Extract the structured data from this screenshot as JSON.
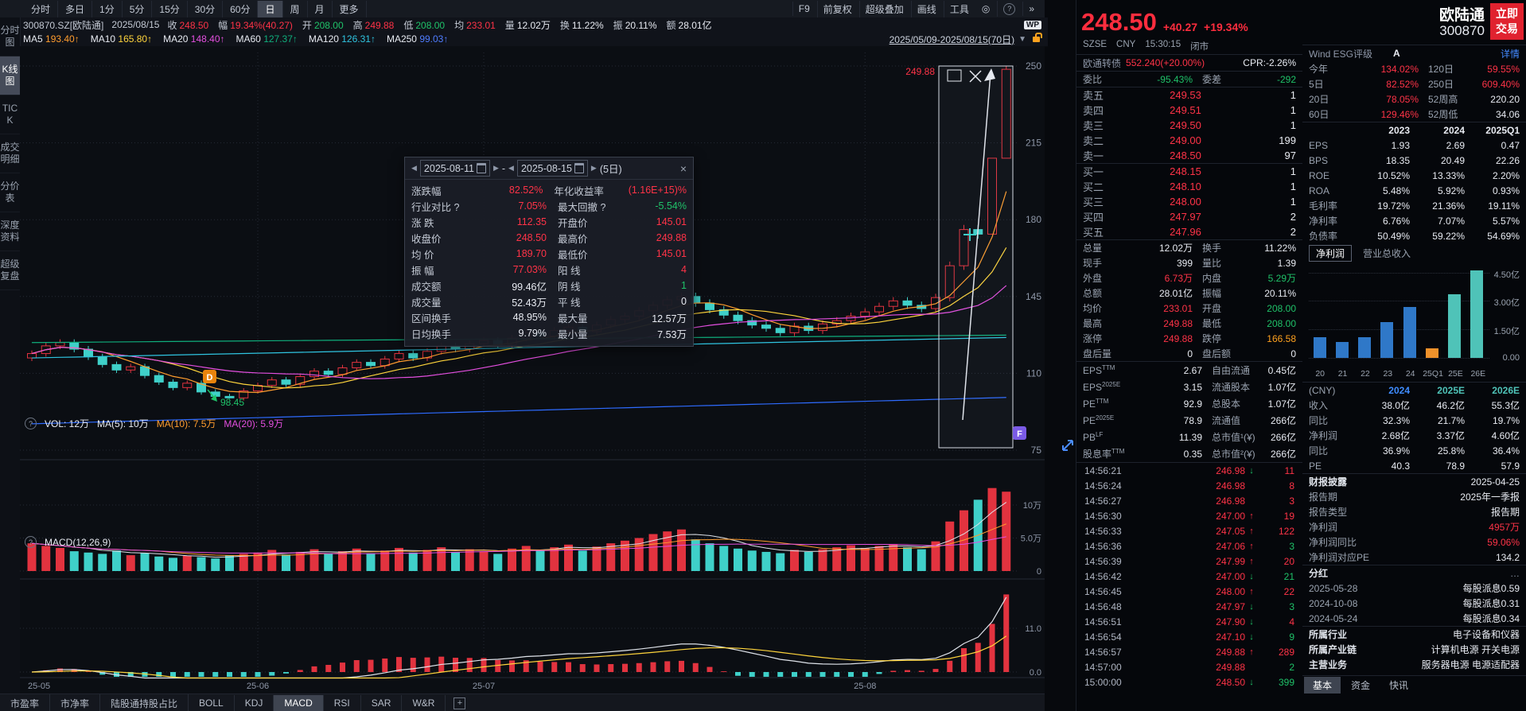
{
  "palette": {
    "red": "#ff3347",
    "green": "#1fc269",
    "teal": "#3fd0c9",
    "candle_red": "#e2333f",
    "orange": "#ff9d2e",
    "yellow": "#ffd53c",
    "magenta": "#e44fe0",
    "ma_green": "#0fae7c",
    "cyan": "#2fc4e0",
    "blue": "#2e6bff",
    "link": "#448aff",
    "gold": "#ffa21f",
    "badge_d": "#e8830c",
    "badge_f": "#7b5be6"
  },
  "top_tabs": {
    "items": [
      "分时",
      "多日",
      "1分",
      "5分",
      "15分",
      "30分",
      "60分",
      "日",
      "周",
      "月",
      "更多"
    ],
    "active": "日",
    "right": [
      "F9",
      "前复权",
      "超级叠加",
      "画线",
      "工具"
    ]
  },
  "info_bar": {
    "code": "300870.SZ[欧陆通]",
    "date": "2025/08/15",
    "wp": "WP",
    "fields": [
      [
        "收",
        "248.50",
        "r"
      ],
      [
        "幅",
        "19.34%(40.27)",
        "r"
      ],
      [
        "开",
        "208.00",
        "g"
      ],
      [
        "高",
        "249.88",
        "r"
      ],
      [
        "低",
        "208.00",
        "g"
      ],
      [
        "均",
        "233.01",
        "r"
      ],
      [
        "量",
        "12.02万",
        "w"
      ],
      [
        "换",
        "11.22%",
        "w"
      ],
      [
        "振",
        "20.11%",
        "w"
      ],
      [
        "额",
        "28.01亿",
        "w"
      ]
    ]
  },
  "ma_bar": {
    "items": [
      [
        "MA5",
        "193.40↑",
        "org"
      ],
      [
        "MA10",
        "165.80↑",
        "yel"
      ],
      [
        "MA20",
        "148.40↑",
        "mag"
      ],
      [
        "MA60",
        "127.37↑",
        "magreen"
      ],
      [
        "MA120",
        "126.31↑",
        "cyan"
      ],
      [
        "MA250",
        "99.03↑",
        "blue"
      ]
    ],
    "range": "2025/05/09-2025/08/15(70日)"
  },
  "sidebar": {
    "items": [
      "分时图",
      "K线图",
      "TICK",
      "成交明细",
      "分价表",
      "深度资料",
      "超级复盘"
    ],
    "active": "K线图"
  },
  "chart": {
    "closes": [
      119.0,
      122.5,
      124.0,
      121.0,
      117.5,
      114.0,
      111.5,
      113.0,
      109.0,
      106.0,
      103.5,
      105.5,
      101.5,
      99.5,
      98.8,
      102.0,
      104.5,
      107.0,
      105.0,
      108.5,
      111.0,
      109.5,
      112.5,
      115.0,
      113.5,
      116.5,
      119.0,
      117.0,
      120.0,
      122.5,
      121.0,
      123.5,
      125.0,
      123.0,
      126.0,
      128.5,
      127.0,
      129.5,
      131.0,
      129.0,
      132.0,
      134.5,
      136.0,
      138.5,
      141.0,
      143.5,
      145.0,
      142.0,
      139.0,
      136.5,
      134.0,
      132.0,
      130.5,
      128.5,
      131.5,
      129.5,
      132.5,
      134.0,
      136.0,
      138.0,
      140.5,
      143.0,
      141.0,
      139.5,
      144.5,
      159.0,
      175.5,
      173.4,
      208.0,
      248.5
    ],
    "vols": [
      4.2,
      3.8,
      3.5,
      3.0,
      2.8,
      2.6,
      3.1,
      2.4,
      2.7,
      2.2,
      2.0,
      2.3,
      2.1,
      1.9,
      2.4,
      2.6,
      2.8,
      3.2,
      2.5,
      2.9,
      3.3,
      2.6,
      3.0,
      3.4,
      2.7,
      3.1,
      3.5,
      2.8,
      3.2,
      3.6,
      2.9,
      3.3,
      3.0,
      2.6,
      3.4,
      3.8,
      3.2,
      3.6,
      4.0,
      3.1,
      3.7,
      4.2,
      4.6,
      5.0,
      5.6,
      6.0,
      6.3,
      4.8,
      4.2,
      3.8,
      3.4,
      3.1,
      2.9,
      2.7,
      3.2,
      2.9,
      3.3,
      3.6,
      3.9,
      3.5,
      3.8,
      4.1,
      3.6,
      3.3,
      4.5,
      7.5,
      9.2,
      10.8,
      12.57,
      12.02
    ],
    "overrides": {
      "14": {
        "low": 98.45
      },
      "68": {
        "open": 173.4,
        "high": 208.0,
        "low": 173.4
      },
      "69": {
        "open": 208.0,
        "high": 249.88,
        "low": 208.0
      }
    },
    "months": [
      [
        "25-05",
        0
      ],
      [
        "25-06",
        16
      ],
      [
        "25-07",
        32
      ],
      [
        "25-08",
        59
      ]
    ],
    "y_labels": [
      250,
      215,
      180,
      145,
      110,
      75
    ],
    "ma_synth": {
      "ma60": [
        124.0,
        127.4
      ],
      "ma120": [
        117.0,
        126.3
      ],
      "ma250": [
        87.0,
        99.0
      ]
    },
    "vol_axis": [
      "10万",
      "5.0万",
      "0"
    ],
    "macd_axis": [
      "11.0",
      "0.0"
    ],
    "overlays": {
      "d_badge": "D",
      "f_badge": "F",
      "low_label": "98.45",
      "sel_high": "249.88"
    }
  },
  "vol_row": {
    "vol": "VOL: 12万",
    "ma5": "MA(5): 10万",
    "ma10": "MA(10): 7.5万",
    "ma20": "MA(20): 5.9万"
  },
  "macd_row": {
    "label": "MACD(12,26,9)"
  },
  "bottom_tabs": {
    "items": [
      "市盈率",
      "市净率",
      "陆股通持股占比",
      "BOLL",
      "KDJ",
      "MACD",
      "RSI",
      "SAR",
      "W&R"
    ],
    "active": "MACD"
  },
  "tooltip": {
    "start": "2025-08-11",
    "end": "2025-08-15",
    "period": "(5日)",
    "close": "×",
    "rows": [
      [
        "涨跌幅",
        "82.52%",
        "r",
        "年化收益率",
        "(1.16E+15)%",
        "r"
      ],
      [
        "行业对比 ?",
        "7.05%",
        "r",
        "最大回撤 ?",
        "-5.54%",
        "g"
      ],
      [
        "涨 跌",
        "112.35",
        "r",
        "开盘价",
        "145.01",
        "r"
      ],
      [
        "收盘价",
        "248.50",
        "r",
        "最高价",
        "249.88",
        "r"
      ],
      [
        "均 价",
        "189.70",
        "r",
        "最低价",
        "145.01",
        "r"
      ],
      [
        "振 幅",
        "77.03%",
        "r",
        "阳 线",
        "4",
        "r"
      ],
      [
        "成交额",
        "99.46亿",
        "w",
        "阴 线",
        "1",
        "g"
      ],
      [
        "成交量",
        "52.43万",
        "w",
        "平 线",
        "0",
        "w"
      ],
      [
        "区间换手",
        "48.95%",
        "w",
        "最大量",
        "12.57万",
        "w"
      ],
      [
        "日均换手",
        "9.79%",
        "w",
        "最小量",
        "7.53万",
        "w"
      ]
    ]
  },
  "quote": {
    "price": "248.50",
    "chg": "+40.27",
    "pct": "+19.34%",
    "meta": [
      "SZSE",
      "CNY",
      "15:30:15",
      "闭市"
    ],
    "bond": {
      "name": "欧通转债",
      "val": "552.240(+20.00%)",
      "cpr": "CPR:-2.26%"
    },
    "wb": [
      "委比",
      "-95.43%",
      "g",
      "委差",
      "-292",
      "g"
    ],
    "asks": [
      [
        "卖五",
        "249.53",
        "1"
      ],
      [
        "卖四",
        "249.51",
        "1"
      ],
      [
        "卖三",
        "249.50",
        "1"
      ],
      [
        "卖二",
        "249.00",
        "199"
      ],
      [
        "卖一",
        "248.50",
        "97"
      ]
    ],
    "bids": [
      [
        "买一",
        "248.15",
        "1"
      ],
      [
        "买二",
        "248.10",
        "1"
      ],
      [
        "买三",
        "248.00",
        "1"
      ],
      [
        "买四",
        "247.97",
        "2"
      ],
      [
        "买五",
        "247.96",
        "2"
      ]
    ],
    "stats": [
      [
        "总量",
        "12.02万",
        "w",
        "换手",
        "11.22%",
        "w"
      ],
      [
        "现手",
        "399",
        "w",
        "量比",
        "1.39",
        "w"
      ],
      [
        "外盘",
        "6.73万",
        "r",
        "内盘",
        "5.29万",
        "g"
      ],
      [
        "总额",
        "28.01亿",
        "w",
        "振幅",
        "20.11%",
        "w"
      ],
      [
        "均价",
        "233.01",
        "r",
        "开盘",
        "208.00",
        "g"
      ],
      [
        "最高",
        "249.88",
        "r",
        "最低",
        "208.00",
        "g"
      ],
      [
        "涨停",
        "249.88",
        "r",
        "跌停",
        "166.58",
        "o"
      ],
      [
        "盘后量",
        "0",
        "w",
        "盘后额",
        "0",
        "w"
      ]
    ],
    "fins": [
      [
        "EPS",
        "TTM",
        "2.67",
        "自由流通",
        "0.45亿"
      ],
      [
        "EPS",
        "2025E",
        "3.15",
        "流通股本",
        "1.07亿"
      ],
      [
        "PE",
        "TTM",
        "92.9",
        "总股本",
        "1.07亿"
      ],
      [
        "PE",
        "2025E",
        "78.9",
        "流通值",
        "266亿"
      ],
      [
        "PB",
        "LF",
        "11.39",
        "总市值¹(¥)",
        "266亿"
      ],
      [
        "股息率",
        "TTM",
        "0.35",
        "总市值²(¥)",
        "266亿"
      ]
    ],
    "ticks": [
      [
        "14:56:21",
        "246.98",
        "down",
        "11",
        "r"
      ],
      [
        "14:56:24",
        "246.98",
        "",
        "8",
        "r"
      ],
      [
        "14:56:27",
        "246.98",
        "",
        "3",
        "r"
      ],
      [
        "14:56:30",
        "247.00",
        "up",
        "19",
        "r"
      ],
      [
        "14:56:33",
        "247.05",
        "up",
        "122",
        "r"
      ],
      [
        "14:56:36",
        "247.06",
        "up",
        "3",
        "g"
      ],
      [
        "14:56:39",
        "247.99",
        "up",
        "20",
        "r"
      ],
      [
        "14:56:42",
        "247.00",
        "down",
        "21",
        "g"
      ],
      [
        "14:56:45",
        "248.00",
        "up",
        "22",
        "r"
      ],
      [
        "14:56:48",
        "247.97",
        "down",
        "3",
        "g"
      ],
      [
        "14:56:51",
        "247.90",
        "down",
        "4",
        "r"
      ],
      [
        "14:56:54",
        "247.10",
        "down",
        "9",
        "g"
      ],
      [
        "14:56:57",
        "249.88",
        "up",
        "289",
        "r"
      ],
      [
        "14:57:00",
        "249.88",
        "",
        "2",
        "g"
      ],
      [
        "15:00:00",
        "248.50",
        "down",
        "399",
        "g"
      ]
    ]
  },
  "colB": {
    "name": "欧陆通",
    "code": "300870",
    "trade1": "立即",
    "trade2": "交易",
    "esg": {
      "label": "Wind ESG评级",
      "value": "A",
      "link": "详情"
    },
    "perf": [
      [
        "今年",
        "134.02%",
        "r",
        "120日",
        "59.55%",
        "r"
      ],
      [
        "5日",
        "82.52%",
        "r",
        "250日",
        "609.40%",
        "r"
      ],
      [
        "20日",
        "78.05%",
        "r",
        "52周高",
        "220.20",
        "w"
      ],
      [
        "60日",
        "129.46%",
        "r",
        "52周低",
        "34.06",
        "w"
      ]
    ],
    "fin_table": {
      "headers": [
        "",
        "2023",
        "2024",
        "2025Q1"
      ],
      "rows": [
        [
          "EPS",
          "1.93",
          "2.69",
          "0.47"
        ],
        [
          "BPS",
          "18.35",
          "20.49",
          "22.26"
        ],
        [
          "ROE",
          "10.52%",
          "13.33%",
          "2.20%"
        ],
        [
          "ROA",
          "5.48%",
          "5.92%",
          "0.93%"
        ],
        [
          "毛利率",
          "19.72%",
          "21.36%",
          "19.11%"
        ],
        [
          "净利率",
          "6.76%",
          "7.07%",
          "5.57%"
        ],
        [
          "负债率",
          "50.49%",
          "59.22%",
          "54.69%"
        ]
      ]
    },
    "bar_tabs": {
      "active": "净利润",
      "other": "营业总收入"
    },
    "chart_data": {
      "type": "bar",
      "title": "净利润",
      "categories": [
        "20",
        "21",
        "22",
        "23",
        "24",
        "25Q1",
        "25E",
        "26E"
      ],
      "values": [
        1.1,
        0.85,
        1.1,
        1.9,
        2.68,
        0.5,
        3.37,
        4.6
      ],
      "ylim": [
        0,
        4.95
      ],
      "y_labels": [
        [
          "4.50亿",
          4.5
        ],
        [
          "3.00亿",
          3.0
        ],
        [
          "1.50亿",
          1.5
        ],
        [
          "0.00",
          0
        ]
      ],
      "colors": {
        "hist": "#2f78c8",
        "quarter": "#f0922b",
        "est": "#4fc3b8"
      }
    },
    "cny_table": {
      "headers": [
        "(CNY)",
        "2024",
        "2025E",
        "2026E"
      ],
      "header_colors": [
        "#9aa3b0",
        "#3f8cff",
        "#4fc3b8",
        "#4fc3b8"
      ],
      "rows": [
        [
          "收入",
          "38.0亿",
          "46.2亿",
          "55.3亿",
          "w"
        ],
        [
          "同比",
          "32.3%",
          "21.7%",
          "19.7%",
          "r"
        ],
        [
          "净利润",
          "2.68亿",
          "3.37亿",
          "4.60亿",
          "w"
        ],
        [
          "同比",
          "36.9%",
          "25.8%",
          "36.4%",
          "r"
        ],
        [
          "PE",
          "40.3",
          "78.9",
          "57.9",
          "w"
        ]
      ]
    },
    "report": {
      "title": "财报披露",
      "date": "2025-04-25",
      "rows": [
        [
          "报告期",
          "2025年一季报",
          "w"
        ],
        [
          "报告类型",
          "报告期",
          "w"
        ],
        [
          "净利润",
          "4957万",
          "r"
        ],
        [
          "净利润同比",
          "59.06%",
          "r"
        ],
        [
          "净利润对应PE",
          "134.2",
          "w"
        ]
      ]
    },
    "dividend": {
      "title": "分红",
      "more": "…",
      "rows": [
        [
          "2025-05-28",
          "每股派息0.59"
        ],
        [
          "2024-10-08",
          "每股派息0.31"
        ],
        [
          "2024-05-24",
          "每股派息0.34"
        ]
      ]
    },
    "industry": [
      [
        "所属行业",
        "电子设备和仪器"
      ],
      [
        "所属产业链",
        "计算机电源 开关电源"
      ],
      [
        "主营业务",
        "服务器电源 电源适配器"
      ]
    ],
    "tabs": [
      "基本",
      "资金",
      "快讯"
    ],
    "active_tab": "基本"
  }
}
